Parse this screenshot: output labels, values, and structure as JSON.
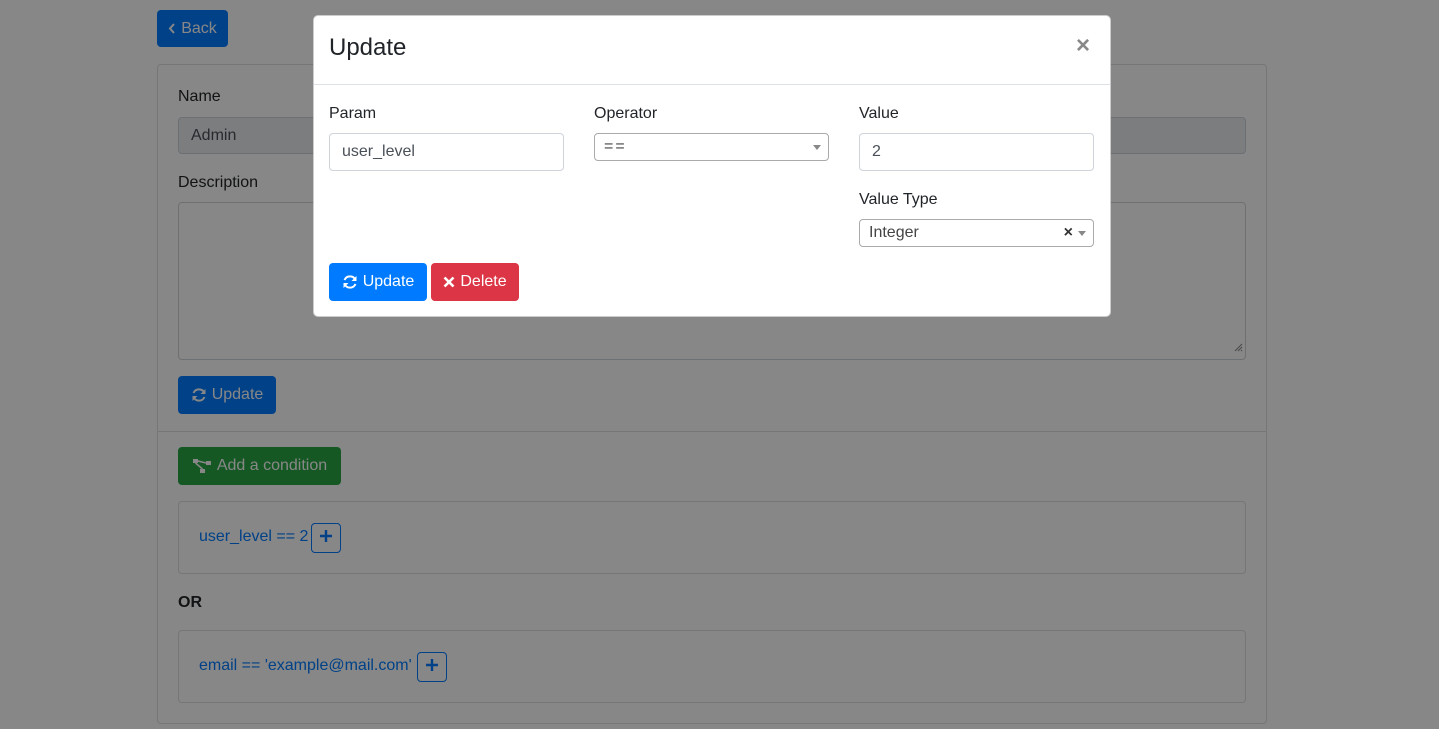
{
  "page": {
    "back_label": "Back",
    "name_label": "Name",
    "name_value": "Admin",
    "description_label": "Description",
    "description_value": "",
    "update_label": "Update",
    "add_condition_label": "Add a condition",
    "or_label": "OR",
    "conditions": [
      {
        "text": "user_level == 2",
        "add_icon": "plus-icon"
      },
      {
        "text": "email == 'example@mail.com'",
        "add_icon": "plus-icon"
      }
    ]
  },
  "modal": {
    "title": "Update",
    "close_label": "×",
    "param_label": "Param",
    "param_value": "user_level",
    "operator_label": "Operator",
    "operator_value": "==",
    "value_label": "Value",
    "value_value": "2",
    "value_type_label": "Value Type",
    "value_type_value": "Integer",
    "value_type_clear": "×",
    "update_label": "Update",
    "delete_label": "Delete"
  },
  "colors": {
    "primary": "#007bff",
    "success": "#28a745",
    "danger": "#dc3545",
    "backdrop": "rgba(0,0,0,0.47)"
  },
  "icons": [
    "chevron-left-icon",
    "refresh-icon",
    "sitemap-icon",
    "plus-icon",
    "times-icon",
    "close-icon"
  ]
}
